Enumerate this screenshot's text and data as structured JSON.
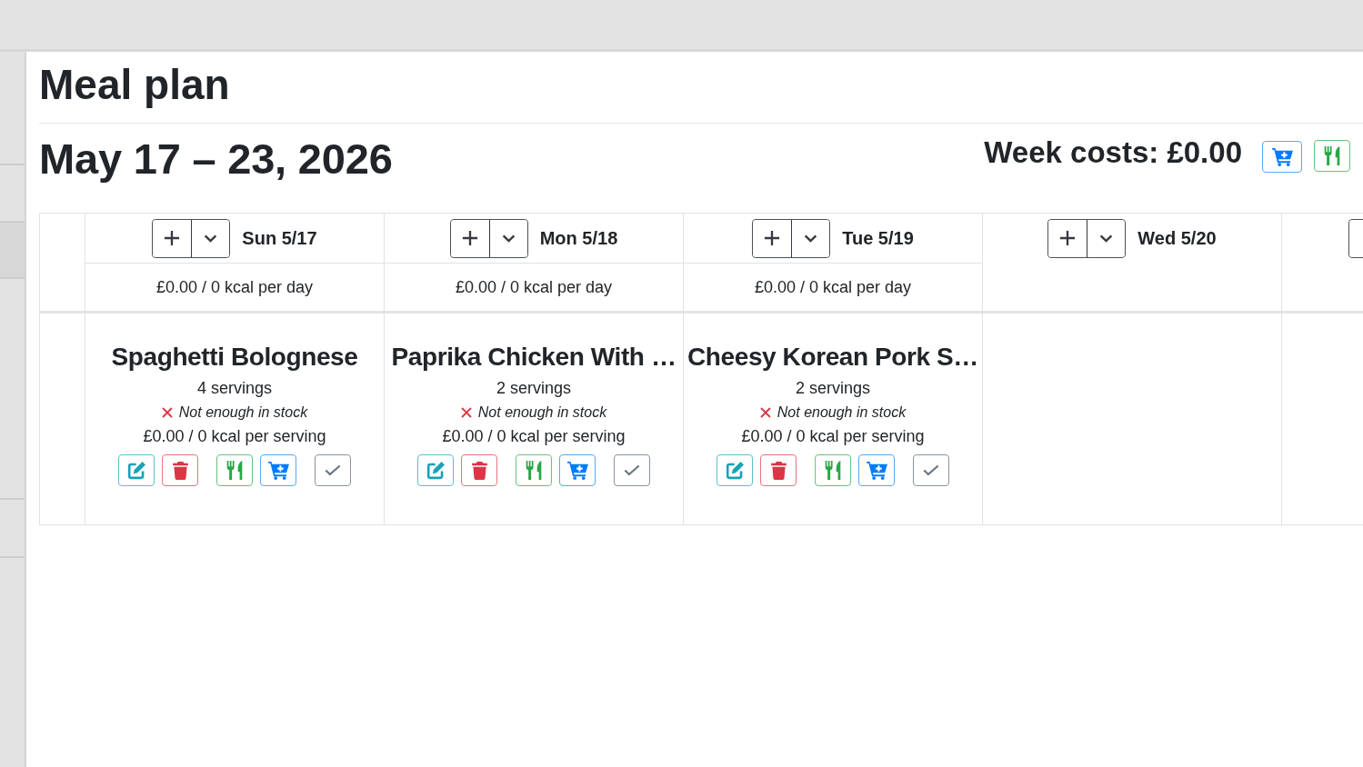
{
  "sidebar": {
    "items": [
      {
        "selected": false
      },
      {
        "selected": false
      },
      {
        "selected": true
      },
      {
        "selected": false
      },
      {
        "selected": false
      },
      {
        "selected": false
      }
    ]
  },
  "page_title": "Meal plan",
  "week": {
    "range": "May 17 – 23, 2026",
    "costs": "Week costs: £0.00"
  },
  "days": [
    {
      "label": "Sun 5/17",
      "summary": "£0.00 / 0 kcal per day",
      "meals": [
        {
          "title": "Spaghetti Bolognese",
          "servings": "4 servings",
          "stock": {
            "enough": false,
            "text": "Not enough in stock"
          },
          "per_serving": "£0.00 / 0 kcal per serving"
        }
      ]
    },
    {
      "label": "Mon 5/18",
      "summary": "£0.00 / 0 kcal per day",
      "meals": [
        {
          "title": "Paprika Chicken With …",
          "servings": "2 servings",
          "stock": {
            "enough": false,
            "text": "Not enough in stock"
          },
          "per_serving": "£0.00 / 0 kcal per serving"
        }
      ]
    },
    {
      "label": "Tue 5/19",
      "summary": "£0.00 / 0 kcal per day",
      "meals": [
        {
          "title": "Cheesy Korean Pork S…",
          "servings": "2 servings",
          "stock": {
            "enough": false,
            "text": "Not enough in stock"
          },
          "per_serving": "£0.00 / 0 kcal per serving"
        }
      ]
    },
    {
      "label": "Wed 5/20"
    }
  ]
}
